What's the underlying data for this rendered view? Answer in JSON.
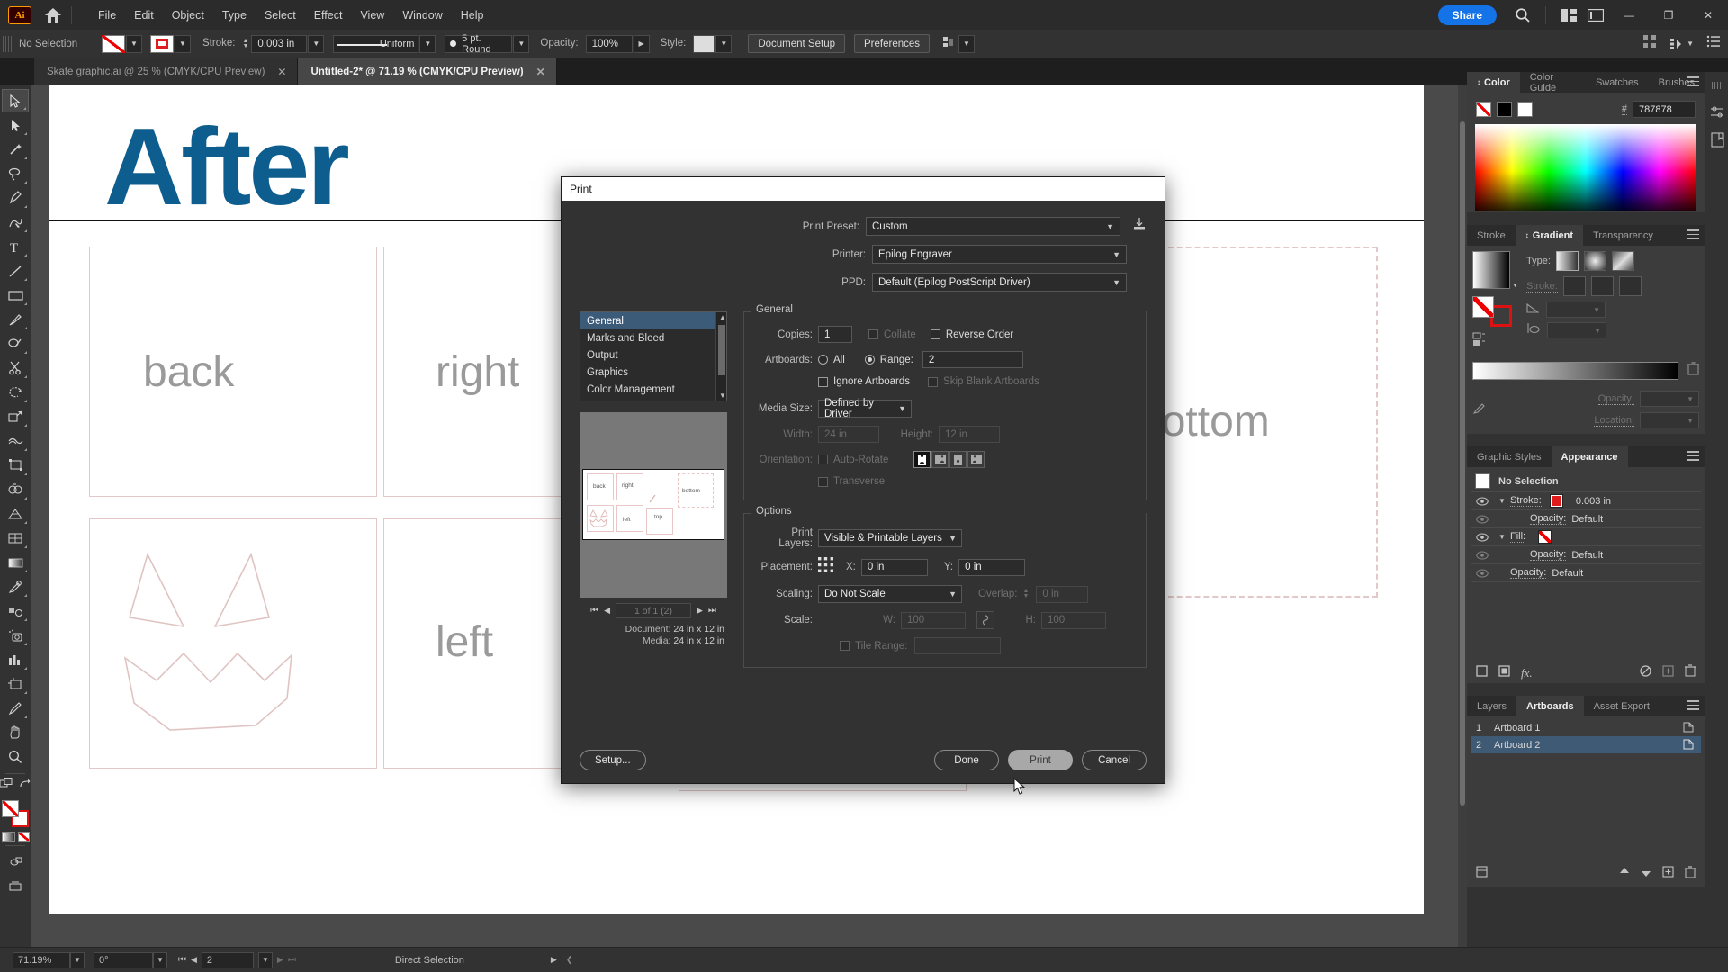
{
  "app": {
    "logo": "Ai",
    "menus": [
      "File",
      "Edit",
      "Object",
      "Type",
      "Select",
      "Effect",
      "View",
      "Window",
      "Help"
    ],
    "share_label": "Share",
    "window_buttons": {
      "minimize": "—",
      "maximize": "❐",
      "close": "✕"
    }
  },
  "control_bar": {
    "selection_status": "No Selection",
    "stroke_label": "Stroke:",
    "stroke_weight": "0.003 in",
    "stroke_profile": "Uniform",
    "brush": "5 pt. Round",
    "opacity_label": "Opacity:",
    "opacity_value": "100%",
    "style_label": "Style:",
    "document_setup": "Document Setup",
    "preferences": "Preferences"
  },
  "tabs": [
    {
      "title": "Skate graphic.ai @ 25 % (CMYK/CPU Preview)",
      "active": false,
      "close": "✕"
    },
    {
      "title": "Untitled-2* @ 71.19 % (CMYK/CPU Preview)",
      "active": true,
      "close": "✕"
    }
  ],
  "canvas": {
    "heading": "After",
    "heading_color": "#0e5d8f",
    "labels": [
      "back",
      "right",
      "bottom",
      "left"
    ]
  },
  "print_dialog": {
    "title": "Print",
    "print_preset_label": "Print Preset:",
    "print_preset_value": "Custom",
    "printer_label": "Printer:",
    "printer_value": "Epilog Engraver",
    "ppd_label": "PPD:",
    "ppd_value": "Default (Epilog PostScript Driver)",
    "categories": [
      "General",
      "Marks and Bleed",
      "Output",
      "Graphics",
      "Color Management"
    ],
    "selected_category": "General",
    "general": {
      "group_title": "General",
      "copies_label": "Copies:",
      "copies_value": "1",
      "collate_label": "Collate",
      "reverse_order_label": "Reverse Order",
      "artboards_label": "Artboards:",
      "all_label": "All",
      "range_label": "Range:",
      "range_value": "2",
      "ignore_artboards_label": "Ignore Artboards",
      "skip_blank_label": "Skip Blank Artboards",
      "media_size_label": "Media Size:",
      "media_size_value": "Defined by Driver",
      "width_label": "Width:",
      "width_value": "24 in",
      "height_label": "Height:",
      "height_value": "12 in",
      "orientation_label": "Orientation:",
      "auto_rotate_label": "Auto-Rotate",
      "transverse_label": "Transverse"
    },
    "options": {
      "group_title": "Options",
      "print_layers_label": "Print Layers:",
      "print_layers_value": "Visible & Printable Layers",
      "placement_label": "Placement:",
      "x_label": "X:",
      "x_value": "0 in",
      "y_label": "Y:",
      "y_value": "0 in",
      "scaling_label": "Scaling:",
      "scaling_value": "Do Not Scale",
      "overlap_label": "Overlap:",
      "overlap_value": "0 in",
      "scale_label": "Scale:",
      "w_label": "W:",
      "w_value": "100",
      "h_label": "H:",
      "h_value": "100",
      "tile_range_label": "Tile Range:",
      "tile_range_value": ""
    },
    "preview": {
      "page_indicator": "1 of 1 (2)",
      "document_label": "Document:",
      "document_value": "24 in x 12 in",
      "media_label": "Media:",
      "media_value": "24 in x 12 in",
      "thumbnail_labels": [
        "back",
        "right",
        "top",
        "left",
        "bottom"
      ]
    },
    "buttons": {
      "setup": "Setup...",
      "done": "Done",
      "print": "Print",
      "cancel": "Cancel"
    }
  },
  "panels": {
    "color": {
      "tabs": [
        "Color",
        "Color Guide",
        "Swatches",
        "Brushes"
      ],
      "active_tab": "Color",
      "hex_symbol": "#",
      "hex_value": "787878"
    },
    "gradient": {
      "tabs": [
        "Stroke",
        "Gradient",
        "Transparency"
      ],
      "active_tab": "Gradient",
      "type_label": "Type:",
      "stroke_label": "Stroke:",
      "opacity_label": "Opacity:",
      "location_label": "Location:"
    },
    "appearance": {
      "tabs": [
        "Graphic Styles",
        "Appearance"
      ],
      "active_tab": "Appearance",
      "rows": [
        {
          "label": "No Selection",
          "value": ""
        },
        {
          "label": "Stroke:",
          "value": "0.003 in"
        },
        {
          "label": "Opacity:",
          "value": "Default"
        },
        {
          "label": "Fill:",
          "value": ""
        },
        {
          "label": "Opacity:",
          "value": "Default"
        },
        {
          "label": "Opacity:",
          "value": "Default"
        }
      ]
    },
    "artboards": {
      "tabs": [
        "Layers",
        "Artboards",
        "Asset Export"
      ],
      "active_tab": "Artboards",
      "items": [
        {
          "num": "1",
          "name": "Artboard 1",
          "selected": false
        },
        {
          "num": "2",
          "name": "Artboard 2",
          "selected": true
        }
      ]
    }
  },
  "status_bar": {
    "zoom": "71.19%",
    "rotation": "0°",
    "artboard_number": "2",
    "tool_name": "Direct Selection"
  }
}
